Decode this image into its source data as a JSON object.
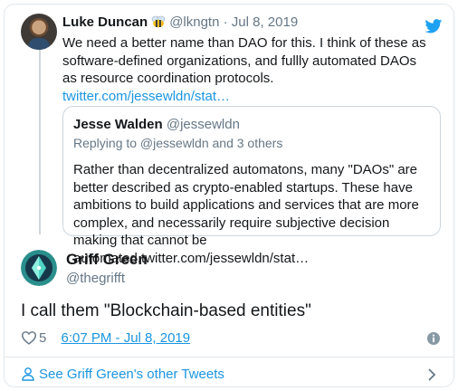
{
  "parent": {
    "author_name": "Luke Duncan",
    "author_handle": "@lkngtn",
    "date": "· Jul 8, 2019",
    "text": "We need a better name than DAO for this. I think of these as software-defined organizations, and fullly automated DAOs as resource coordination protocols. ",
    "link": "twitter.com/jessewldn/stat…",
    "icon": "bee-emoji"
  },
  "quote": {
    "author_name": "Jesse Walden",
    "author_handle": "@jessewldn",
    "reply_to": "Replying to @jessewldn and 3 others",
    "text": "Rather than decentralized automatons, many \"DAOs\" are better described as crypto-enabled startups. These have ambitions to build applications and services that are more complex, and necessarily require subjective decision making that cannot be automated.twitter.com/jessewldn/stat…"
  },
  "tweet": {
    "author_name": "Griff Green",
    "author_handle": "@thegrifft",
    "text": "I call them \"Blockchain-based entities\"",
    "likes": "5",
    "timestamp": "6:07 PM - Jul 8, 2019"
  },
  "footer": {
    "label": "See Griff Green's other Tweets"
  },
  "colors": {
    "link": "#1b95e0",
    "muted": "#657786",
    "border": "#e1e8ed"
  }
}
